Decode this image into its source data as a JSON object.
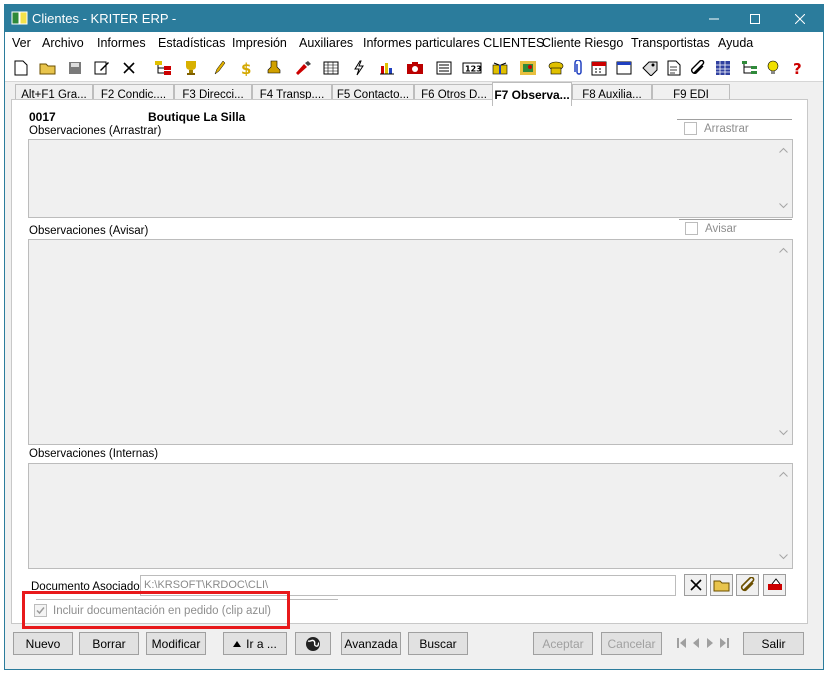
{
  "window": {
    "title": "Clientes - KRITER ERP -"
  },
  "menu": [
    "Ver",
    "Archivo",
    "Informes",
    "Estadísticas",
    "Impresión",
    "Auxiliares",
    "Informes particulares CLIENTES",
    "Cliente Riesgo",
    "Transportistas",
    "Ayuda"
  ],
  "toolbar_icons": [
    "new-icon",
    "open-folder-icon",
    "save-icon",
    "edit-icon",
    "close-icon",
    "hierarchy-icon",
    "trophy-icon",
    "pen-icon",
    "money-icon",
    "stamp-icon",
    "paint-icon",
    "grid-icon",
    "lightning-icon",
    "bar-chart-icon",
    "camera-icon",
    "list-icon",
    "counter-icon",
    "gift-icon",
    "map-icon",
    "phone-icon",
    "paperclip-icon",
    "calendar-icon",
    "window-icon",
    "tag-icon",
    "notes-icon",
    "attach-icon",
    "table-icon",
    "tree-icon",
    "bulb-icon",
    "help-icon"
  ],
  "tabs": [
    "Alt+F1 Gra...",
    "F2 Condic....",
    "F3 Direcci...",
    "F4 Transp....",
    "F5 Contacto...",
    "F6 Otros D...",
    "F7 Observa...",
    "F8 Auxilia...",
    "F9 EDI"
  ],
  "active_tab": "F7 Observa...",
  "client": {
    "code": "0017",
    "name": "Boutique La Silla"
  },
  "sections": {
    "arrastrar": {
      "label": "Observaciones (Arrastrar)",
      "checkbox": "Arrastrar"
    },
    "avisar": {
      "label": "Observaciones (Avisar)",
      "checkbox": "Avisar"
    },
    "internas": {
      "label": "Observaciones (Internas)"
    }
  },
  "documento": {
    "label": "Documento Asociado",
    "value": "K:\\KRSOFT\\KRDOC\\CLI\\"
  },
  "incluir": {
    "label": "Incluir documentación en pedido (clip azul)",
    "checked": true
  },
  "buttons": {
    "nuevo": "Nuevo",
    "borrar": "Borrar",
    "modificar": "Modificar",
    "ira": "Ir a ...",
    "avanzada": "Avanzada",
    "buscar": "Buscar",
    "aceptar": "Aceptar",
    "cancelar": "Cancelar",
    "salir": "Salir"
  },
  "colors": {
    "titlebar": "#2b7c9c",
    "highlight": "#e8191b",
    "memo_bg": "#f0f0f0"
  }
}
